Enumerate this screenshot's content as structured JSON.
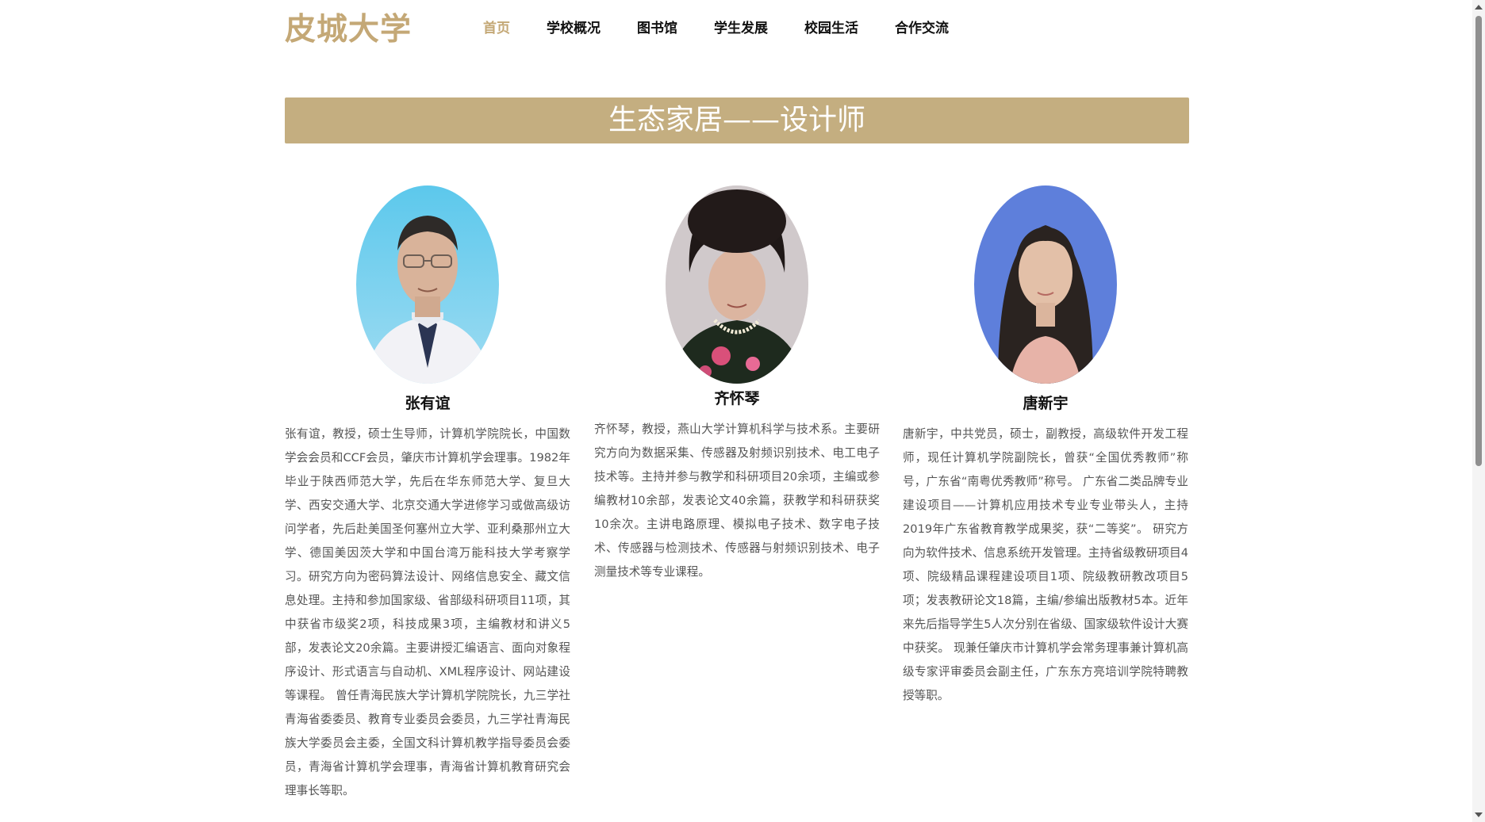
{
  "header": {
    "brand": "皮城大学",
    "nav": [
      "首页",
      "学校概况",
      "图书馆",
      "学生发展",
      "校园生活",
      "合作交流"
    ],
    "active_index": 0
  },
  "banner": {
    "title": "生态家居——设计师"
  },
  "profiles": [
    {
      "name": "张有谊",
      "bio": "张有谊，教授，硕士生导师，计算机学院院长，中国数学会会员和CCF会员，肇庆市计算机学会理事。1982年毕业于陕西师范大学，先后在华东师范大学、复旦大学、西安交通大学、北京交通大学进修学习或做高级访问学者，先后赴美国圣何塞州立大学、亚利桑那州立大学、德国美因茨大学和中国台湾万能科技大学考察学习。研究方向为密码算法设计、网络信息安全、藏文信息处理。主持和参加国家级、省部级科研项目11项，其中获省市级奖2项，科技成果3项，主编教材和讲义5部，发表论文20余篇。主要讲授汇编语言、面向对象程序设计、形式语言与自动机、XML程序设计、网站建设等课程。 曾任青海民族大学计算机学院院长，九三学社青海省委委员、教育专业委员会委员，九三学社青海民族大学委员会主委，全国文科计算机教学指导委员会委员，青海省计算机学会理事，青海省计算机教育研究会理事长等职。"
    },
    {
      "name": "齐怀琴",
      "bio": "齐怀琴，教授，燕山大学计算机科学与技术系。主要研究方向为数据采集、传感器及射频识别技术、电工电子技术等。主持并参与教学和科研项目20余项，主编或参编教材10余部，发表论文40余篇，获教学和科研获奖10余次。主讲电路原理、模拟电子技术、数字电子技术、传感器与检测技术、传感器与射频识别技术、电子测量技术等专业课程。"
    },
    {
      "name": "唐新宇",
      "bio": "唐新宇，中共党员，硕士，副教授，高级软件开发工程师，现任计算机学院副院长，曾获“全国优秀教师”称号，广东省“南粤优秀教师”称号。 广东省二类品牌专业建设项目——计算机应用技术专业专业带头人，主持2019年广东省教育教学成果奖，获“二等奖”。 研究方向为软件技术、信息系统开发管理。主持省级教研项目4项、院级精品课程建设项目1项、院级教研教改项目5项；发表教研论文18篇，主编/参编出版教材5本。近年来先后指导学生5人次分别在省级、国家级软件设计大赛中获奖。 现兼任肇庆市计算机学会常务理事兼计算机高级专家评审委员会副主任，广东东方亮培训学院特聘教授等职。"
    }
  ],
  "colors": {
    "accent": "#c4a876",
    "banner_bg": "#c4ae80",
    "text": "#555555"
  },
  "icons": [
    "scroll-up-icon",
    "scroll-down-icon"
  ]
}
